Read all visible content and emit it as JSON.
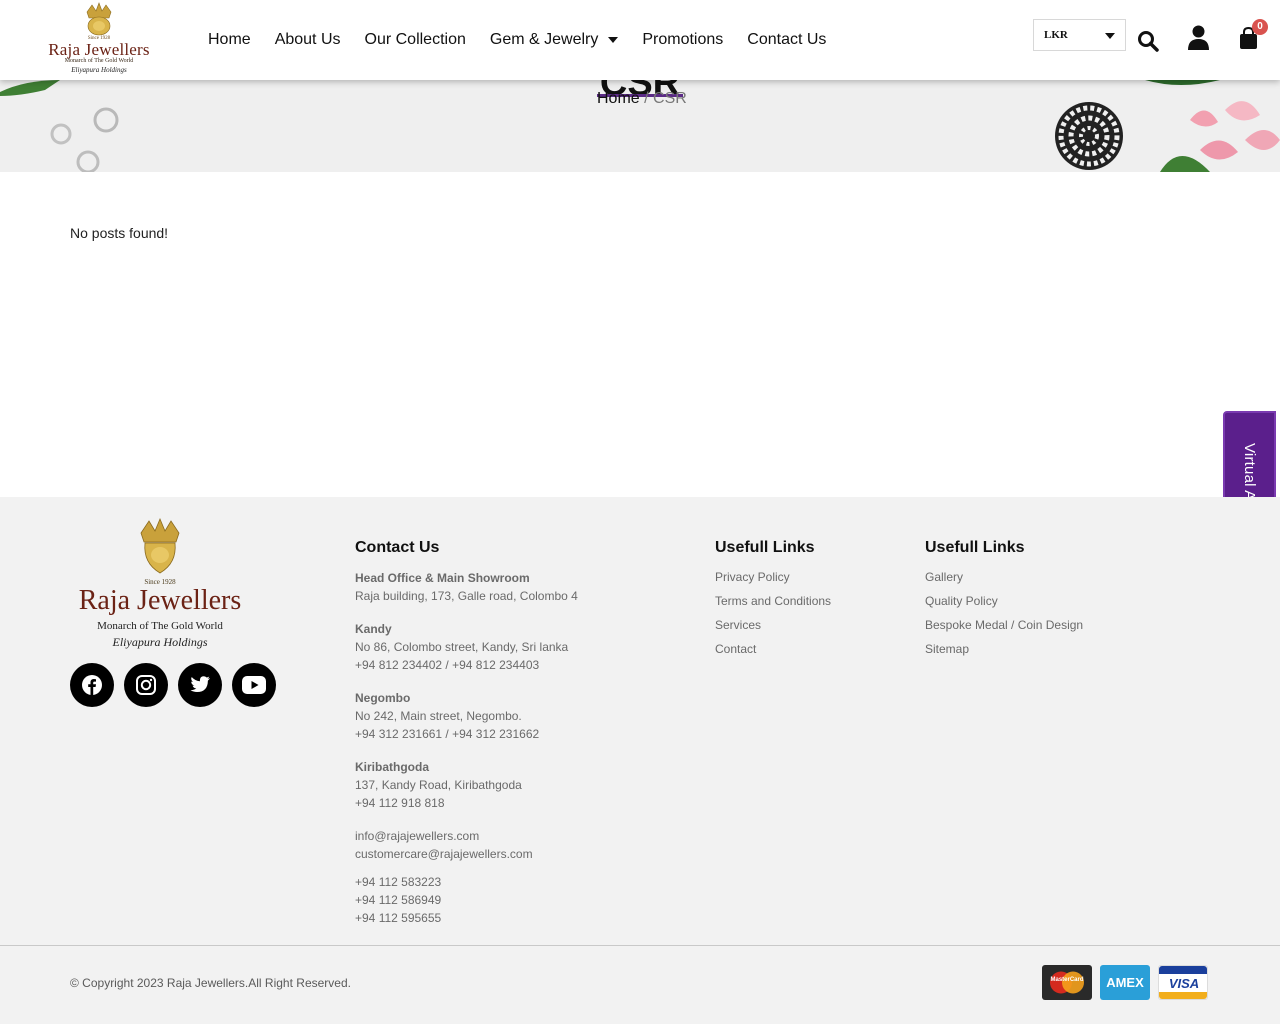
{
  "header": {
    "logo": {
      "since": "Since 1928",
      "brand": "Raja Jewellers",
      "tagline": "Monarch of The Gold World",
      "holding": "Eliyapura Holdings"
    },
    "nav": [
      {
        "label": "Home"
      },
      {
        "label": "About Us"
      },
      {
        "label": "Our Collection"
      },
      {
        "label": "Gem & Jewelry"
      },
      {
        "label": "Promotions"
      },
      {
        "label": "Contact Us"
      }
    ],
    "currency": "LKR",
    "cart_count": "0"
  },
  "banner": {
    "title": "CSR",
    "breadcrumb_home": "Home",
    "breadcrumb_sep": " / ",
    "breadcrumb_current": "CSR"
  },
  "main": {
    "message": "No posts found!"
  },
  "virtual_tab": "Virtual Appointments",
  "footer": {
    "logo": {
      "since": "Since 1928",
      "brand": "Raja Jewellers",
      "tagline": "Monarch of The Gold World",
      "holding": "Eliyapura Holdings"
    },
    "contact_heading": "Contact Us",
    "contact_groups": [
      {
        "title": "Head Office & Main Showroom",
        "lines": [
          "Raja building, 173, Galle road, Colombo 4"
        ]
      },
      {
        "title": "Kandy",
        "lines": [
          "No 86, Colombo street, Kandy, Sri lanka",
          "+94 812 234402 / +94 812 234403"
        ]
      },
      {
        "title": "Negombo",
        "lines": [
          "No 242, Main street, Negombo.",
          "+94 312 231661 / +94 312 231662"
        ]
      },
      {
        "title": "Kiribathgoda",
        "lines": [
          "137, Kandy Road, Kiribathgoda",
          "+94 112 918 818"
        ]
      },
      {
        "title": "",
        "lines": [
          "info@rajajewellers.com",
          "customercare@rajajewellers.com"
        ]
      },
      {
        "title": "",
        "lines": [
          "+94 112 583223",
          "+94 112 586949",
          "+94 112 595655"
        ]
      }
    ],
    "links1_heading": "Usefull Links",
    "links1": [
      "Privacy Policy",
      "Terms and Conditions",
      "Services",
      "Contact"
    ],
    "links2_heading": "Usefull Links",
    "links2": [
      "Gallery",
      "Quality Policy",
      "Bespoke Medal / Coin Design",
      "Sitemap"
    ],
    "copyright": "© Copyright 2023 Raja Jewellers.All Right Reserved.",
    "payments": [
      {
        "name": "MasterCard",
        "color": "#c7281f"
      },
      {
        "name": "AMEX",
        "color": "#2a9fd8"
      },
      {
        "name": "VISA",
        "color": "#1a3f9c"
      }
    ],
    "social_icons": [
      "facebook-icon",
      "instagram-icon",
      "twitter-icon",
      "youtube-icon"
    ]
  },
  "colors": {
    "accent_purple": "#5b1f8c",
    "brand_maroon": "#6b2215",
    "gold": "#c9a13b"
  }
}
